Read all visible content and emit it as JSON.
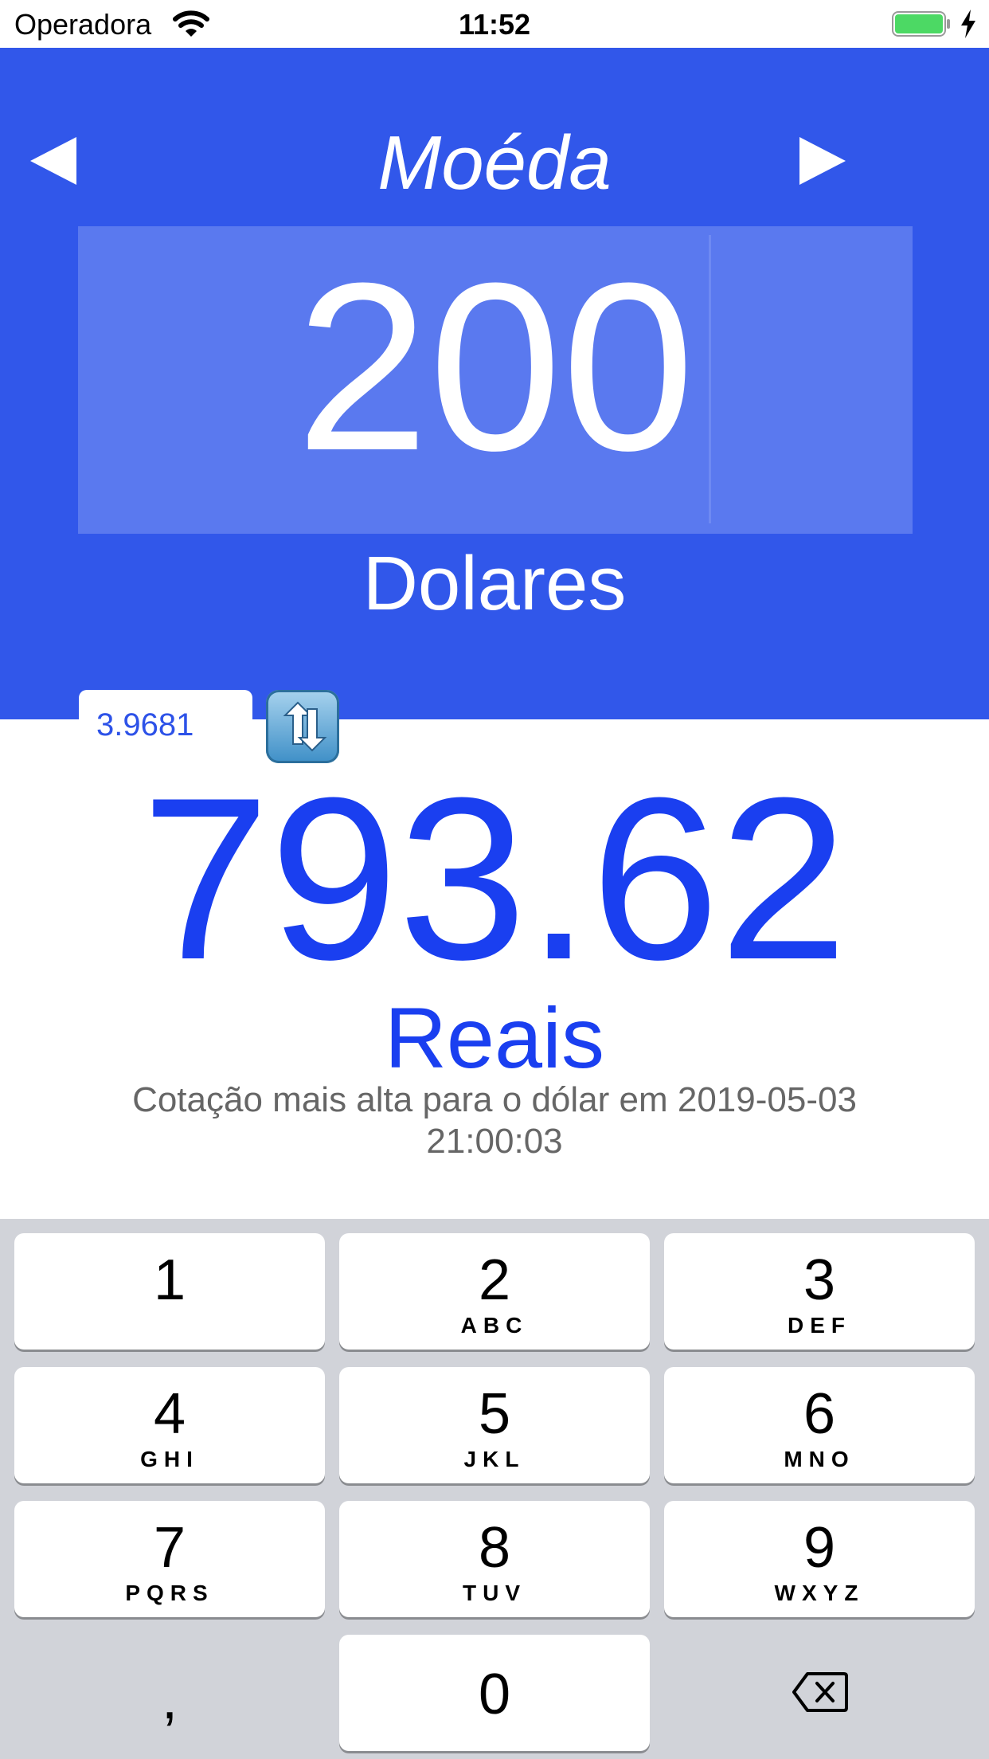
{
  "status_bar": {
    "carrier": "Operadora",
    "time": "11:52"
  },
  "header": {
    "title": "Moéda",
    "amount": "200",
    "from_currency": "Dolares",
    "rate_value": "3.9681",
    "background_color": "#3157ea"
  },
  "result": {
    "value": "793.62",
    "to_currency": "Reais",
    "quote_line1": "Cotação mais alta para o dólar em  2019-05-03",
    "quote_line2": "21:00:03",
    "color": "#1a3ff0"
  },
  "keypad": {
    "keys": [
      {
        "digit": "1",
        "letters": ""
      },
      {
        "digit": "2",
        "letters": "ABC"
      },
      {
        "digit": "3",
        "letters": "DEF"
      },
      {
        "digit": "4",
        "letters": "GHI"
      },
      {
        "digit": "5",
        "letters": "JKL"
      },
      {
        "digit": "6",
        "letters": "MNO"
      },
      {
        "digit": "7",
        "letters": "PQRS"
      },
      {
        "digit": "8",
        "letters": "TUV"
      },
      {
        "digit": "9",
        "letters": "WXYZ"
      },
      {
        "digit": "0",
        "letters": ""
      }
    ],
    "decimal_key": ",",
    "delete_icon": "backspace-icon"
  }
}
